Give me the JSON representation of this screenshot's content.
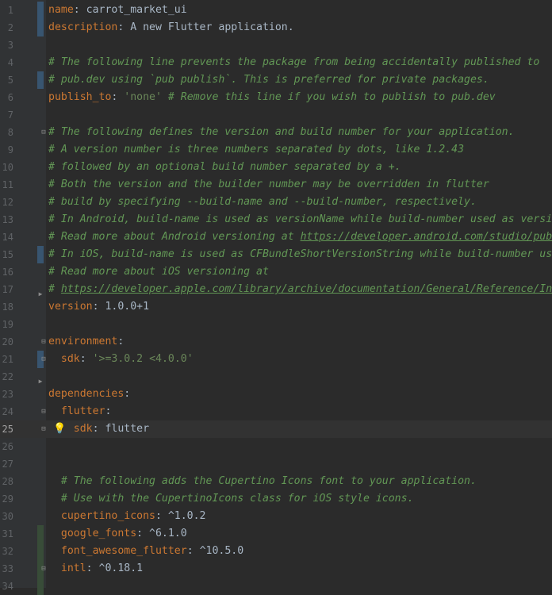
{
  "editor": {
    "current_line": 25,
    "lines": [
      {
        "n": "1",
        "parts": [
          [
            "k",
            "name"
          ],
          [
            "p",
            ": carrot_market_ui"
          ]
        ]
      },
      {
        "n": "2",
        "parts": [
          [
            "k",
            "description"
          ],
          [
            "p",
            ": A new Flutter application."
          ]
        ]
      },
      {
        "n": "3",
        "parts": []
      },
      {
        "n": "4",
        "parts": [
          [
            "c",
            "# The following line prevents the package from being accidentally published to"
          ]
        ]
      },
      {
        "n": "5",
        "parts": [
          [
            "c",
            "# pub.dev using `pub publish`. This is preferred for private packages."
          ]
        ]
      },
      {
        "n": "6",
        "parts": [
          [
            "k",
            "publish_to"
          ],
          [
            "p",
            ": "
          ],
          [
            "s",
            "'none'"
          ],
          [
            "c",
            " # Remove this line if you wish to publish to pub.dev"
          ]
        ]
      },
      {
        "n": "7",
        "parts": []
      },
      {
        "n": "8",
        "parts": [
          [
            "c",
            "# The following defines the version and build number for your application."
          ]
        ]
      },
      {
        "n": "9",
        "parts": [
          [
            "c",
            "# A version number is three numbers separated by dots, like 1.2.43"
          ]
        ]
      },
      {
        "n": "10",
        "parts": [
          [
            "c",
            "# followed by an optional build number separated by a +."
          ]
        ]
      },
      {
        "n": "11",
        "parts": [
          [
            "c",
            "# Both the version and the builder number may be overridden in flutter"
          ]
        ]
      },
      {
        "n": "12",
        "parts": [
          [
            "c",
            "# build by specifying --build-name and --build-number, respectively."
          ]
        ]
      },
      {
        "n": "13",
        "parts": [
          [
            "c",
            "# In Android, build-name is used as versionName while build-number used as versi"
          ]
        ]
      },
      {
        "n": "14",
        "parts": [
          [
            "c",
            "# Read more about Android versioning at "
          ],
          [
            "u",
            "https://developer.android.com/studio/pub"
          ]
        ]
      },
      {
        "n": "15",
        "parts": [
          [
            "c",
            "# In iOS, build-name is used as CFBundleShortVersionString while build-number us"
          ]
        ]
      },
      {
        "n": "16",
        "parts": [
          [
            "c",
            "# Read more about iOS versioning at"
          ]
        ]
      },
      {
        "n": "17",
        "parts": [
          [
            "c",
            "# "
          ],
          [
            "u",
            "https://developer.apple.com/library/archive/documentation/General/Reference/In"
          ]
        ]
      },
      {
        "n": "18",
        "parts": [
          [
            "k",
            "version"
          ],
          [
            "p",
            ": 1.0.0+1"
          ]
        ]
      },
      {
        "n": "19",
        "parts": []
      },
      {
        "n": "20",
        "parts": [
          [
            "k",
            "environment"
          ],
          [
            "p",
            ":"
          ]
        ]
      },
      {
        "n": "21",
        "parts": [
          [
            "p",
            "  "
          ],
          [
            "k",
            "sdk"
          ],
          [
            "p",
            ": "
          ],
          [
            "s",
            "'>=3.0.2 <4.0.0'"
          ]
        ]
      },
      {
        "n": "22",
        "parts": []
      },
      {
        "n": "23",
        "parts": [
          [
            "k",
            "dependencies"
          ],
          [
            "p",
            ":"
          ]
        ]
      },
      {
        "n": "24",
        "parts": [
          [
            "p",
            "  "
          ],
          [
            "k",
            "flutter"
          ],
          [
            "p",
            ":"
          ]
        ]
      },
      {
        "n": "25",
        "parts": [
          [
            "p",
            "    "
          ],
          [
            "k",
            "sdk"
          ],
          [
            "p",
            ": flutter"
          ]
        ]
      },
      {
        "n": "26",
        "parts": []
      },
      {
        "n": "27",
        "parts": []
      },
      {
        "n": "28",
        "parts": [
          [
            "p",
            "  "
          ],
          [
            "c",
            "# The following adds the Cupertino Icons font to your application."
          ]
        ]
      },
      {
        "n": "29",
        "parts": [
          [
            "p",
            "  "
          ],
          [
            "c",
            "# Use with the CupertinoIcons class for iOS style icons."
          ]
        ]
      },
      {
        "n": "30",
        "parts": [
          [
            "p",
            "  "
          ],
          [
            "k",
            "cupertino_icons"
          ],
          [
            "p",
            ": ^1.0.2"
          ]
        ]
      },
      {
        "n": "31",
        "parts": [
          [
            "p",
            "  "
          ],
          [
            "k",
            "google_fonts"
          ],
          [
            "p",
            ": ^6.1.0"
          ]
        ]
      },
      {
        "n": "32",
        "parts": [
          [
            "p",
            "  "
          ],
          [
            "k",
            "font_awesome_flutter"
          ],
          [
            "p",
            ": ^10.5.0"
          ]
        ]
      },
      {
        "n": "33",
        "parts": [
          [
            "p",
            "  "
          ],
          [
            "k",
            "intl"
          ],
          [
            "p",
            ": ^0.18.1"
          ]
        ]
      },
      {
        "n": "34",
        "parts": []
      }
    ],
    "markers": {
      "vcs_modified": [
        "1",
        "2",
        "5",
        "15",
        "21"
      ],
      "vcs_added": [
        "31",
        "32",
        "33",
        "34"
      ],
      "fold_open": [
        "8",
        "20",
        "24",
        "25",
        "33"
      ],
      "fold_close": [
        "21"
      ],
      "fold_collapsed": [
        "17",
        "22"
      ],
      "fold_open_bottom": [
        "16"
      ]
    },
    "intention_icon": "lightbulb-icon",
    "intention_line": "25",
    "colors": {
      "background": "#2b2b2b",
      "key": "#cc7832",
      "string": "#6a8759",
      "comment": "#629755",
      "text": "#a9b7c6",
      "line_number": "#606366"
    }
  }
}
